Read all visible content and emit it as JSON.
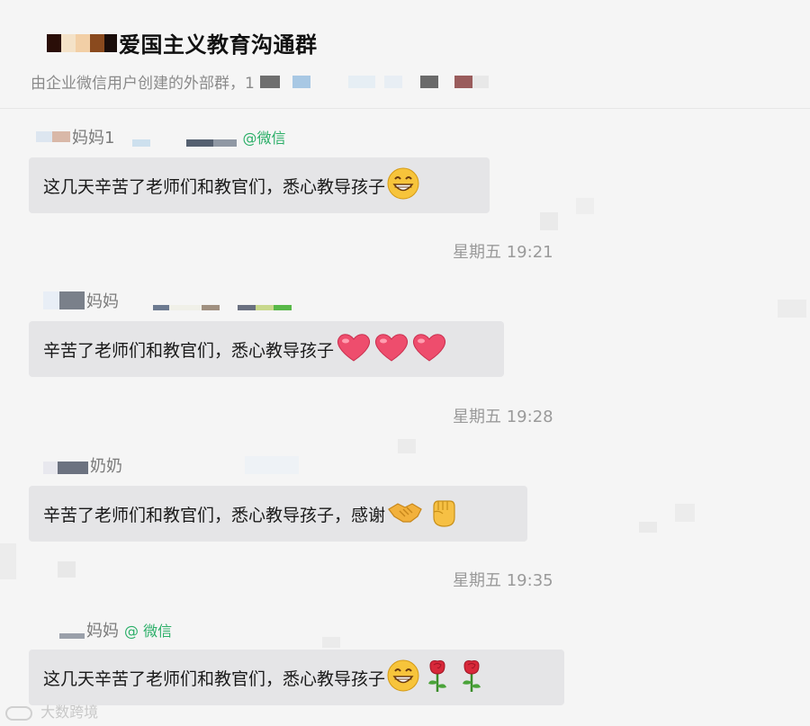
{
  "header": {
    "title": "爱国主义教育沟通群",
    "subtitle": "由企业微信用户创建的外部群，1"
  },
  "messages": [
    {
      "sender": "妈妈1",
      "wechat_tag": "@微信",
      "text": "这几天辛苦了老师们和教官们，悉心教导孩子",
      "emojis": [
        "grin-emoji"
      ],
      "time": "星期五 19:21"
    },
    {
      "sender": "妈妈",
      "wechat_tag": "",
      "text": "辛苦了老师们和教官们，悉心教导孩子",
      "emojis": [
        "heart-emoji",
        "heart-emoji",
        "heart-emoji"
      ],
      "time": "星期五 19:28"
    },
    {
      "sender": "奶奶",
      "wechat_tag": "",
      "text": "辛苦了老师们和教官们，悉心教导孩子，感谢",
      "emojis": [
        "handshake-emoji",
        "fist-emoji"
      ],
      "time": "星期五 19:35"
    },
    {
      "sender": "妈妈",
      "wechat_tag": "@ 微信",
      "text": "这几天辛苦了老师们和教官们，悉心教导孩子",
      "emojis": [
        "grin-emoji",
        "rose-emoji",
        "rose-emoji"
      ],
      "time": ""
    }
  ],
  "watermark": "大数跨境",
  "colors": {
    "wechat_green": "#2aae67",
    "bubble": "#e5e5e7",
    "background": "#f5f5f5"
  }
}
